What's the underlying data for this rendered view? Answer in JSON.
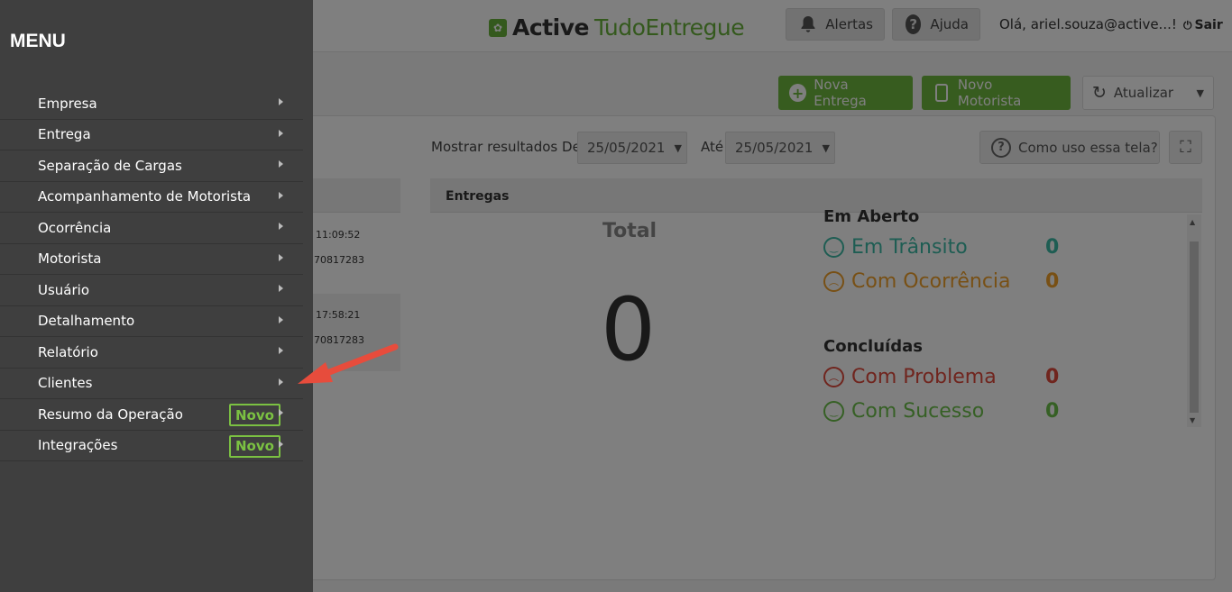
{
  "topbar": {
    "brand_part1": "Active",
    "brand_part2": "TudoEntregue",
    "alerts_label": "Alertas",
    "help_label": "Ajuda",
    "greeting": "Olá, ariel.souza@active...!",
    "logout_label": "Sair"
  },
  "actions": {
    "new_delivery": "Nova Entrega",
    "new_driver": "Novo Motorista",
    "refresh": "Atualizar"
  },
  "filter": {
    "from_label": "Mostrar resultados De",
    "from_date": "25/05/2021",
    "to_label": "Até",
    "to_date": "25/05/2021",
    "help_button": "Como uso essa tela?"
  },
  "left_list": [
    {
      "time": "11:09:52",
      "code": "70817283"
    },
    {
      "time": "17:58:21",
      "code": "70817283"
    }
  ],
  "deliveries": {
    "header": "Entregas",
    "total_label": "Total",
    "total_value": "0",
    "open_heading": "Em Aberto",
    "in_transit_label": "Em Trânsito",
    "in_transit_value": "0",
    "with_occurrence_label": "Com Ocorrência",
    "with_occurrence_value": "0",
    "done_heading": "Concluídas",
    "with_problem_label": "Com Problema",
    "with_problem_value": "0",
    "with_success_label": "Com Sucesso",
    "with_success_value": "0"
  },
  "menu": {
    "title": "MENU",
    "items": [
      {
        "label": "Empresa",
        "badge": ""
      },
      {
        "label": "Entrega",
        "badge": ""
      },
      {
        "label": "Separação de Cargas",
        "badge": ""
      },
      {
        "label": "Acompanhamento de Motorista",
        "badge": ""
      },
      {
        "label": "Ocorrência",
        "badge": ""
      },
      {
        "label": "Motorista",
        "badge": ""
      },
      {
        "label": "Usuário",
        "badge": ""
      },
      {
        "label": "Detalhamento",
        "badge": ""
      },
      {
        "label": "Relatório",
        "badge": ""
      },
      {
        "label": "Clientes",
        "badge": ""
      },
      {
        "label": "Resumo da Operação",
        "badge": "Novo"
      },
      {
        "label": "Integrações",
        "badge": "Novo"
      }
    ]
  },
  "colors": {
    "brand_green": "#69b33b",
    "menu_bg": "#3f3f3f",
    "badge_green": "#7bc142",
    "arrow_red": "#e74c3c",
    "in_transit": "#3dbba6",
    "occurrence": "#f0a12b",
    "problem": "#e04a3c",
    "success": "#6cc04a"
  },
  "icons": {
    "alerts": "bell-icon",
    "help": "question-circle-icon",
    "logout": "power-icon",
    "new_delivery": "plus-circle-icon",
    "new_driver": "phone-icon",
    "refresh": "refresh-icon",
    "fullscreen": "fullscreen-icon",
    "menu_chevron": "chevron-right-icon"
  }
}
